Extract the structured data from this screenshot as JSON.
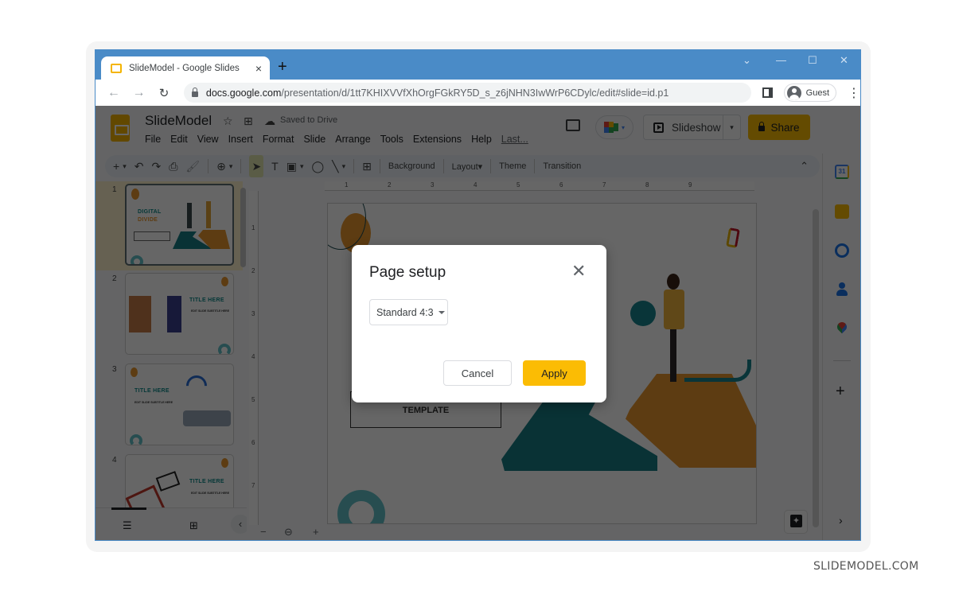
{
  "browser": {
    "tab_title": "SlideModel - Google Slides",
    "tab_close_icon": "×",
    "new_tab_icon": "+",
    "window_controls": {
      "tab_search": "⌄",
      "minimize": "—",
      "maximize": "☐",
      "close": "✕"
    },
    "nav": {
      "back": "←",
      "forward": "→",
      "reload": "↻"
    },
    "url_host": "docs.google.com",
    "url_path": "/presentation/d/1tt7KHIXVVfXhOrgFGkRY5D_s_z6jNHN3IwWrP6CDylc/edit#slide=id.p1",
    "profile_label": "Guest",
    "menu_icon": "⋮"
  },
  "app": {
    "doc_title": "SlideModel",
    "star_icon": "☆",
    "move_icon": "⊞",
    "saved_status": "Saved to Drive",
    "cloud_icon": "☁",
    "menu": [
      "File",
      "Edit",
      "View",
      "Insert",
      "Format",
      "Slide",
      "Arrange",
      "Tools",
      "Extensions",
      "Help"
    ],
    "last_edit": "Last...",
    "slideshow_label": "Slideshow",
    "slideshow_dropdown": "▾",
    "share_label": "Share",
    "meet_dropdown": "▾"
  },
  "toolbar": {
    "new_slide": "+",
    "dropdown": "▾",
    "undo": "↶",
    "redo": "↷",
    "print": "⎙",
    "paint_format": "🖌",
    "zoom": "⊕",
    "select": "➤",
    "textbox": "T",
    "image": "▣",
    "shape": "◯",
    "line": "╲",
    "comment": "⊞",
    "background": "Background",
    "layout": "Layout",
    "layout_caret": "▾",
    "theme": "Theme",
    "transition": "Transition",
    "collapse": "⌃"
  },
  "filmstrip": {
    "slides": [
      {
        "number": "1",
        "title_line1": "DIGITAL",
        "title_line2": "DIVIDE"
      },
      {
        "number": "2",
        "title": "TITLE HERE",
        "subtitle": "EDIT SLIDE SUBTITLE HERE"
      },
      {
        "number": "3",
        "title": "TITLE HERE",
        "subtitle": "EDIT SLIDE SUBTITLE HERE"
      },
      {
        "number": "4",
        "title": "TITLE HERE",
        "subtitle": "EDIT SLIDE SUBTITLE HERE"
      }
    ],
    "list_view_icon": "☰",
    "grid_view_icon": "⊞",
    "collapse_icon": "‹"
  },
  "canvas": {
    "ruler_h_labels": [
      "1",
      "2",
      "3",
      "4",
      "5",
      "6",
      "7",
      "8",
      "9"
    ],
    "ruler_v_labels": [
      "1",
      "2",
      "3",
      "4",
      "5",
      "6",
      "7"
    ],
    "slide_button_text": "TEMPLATE",
    "zoom_out": "−",
    "zoom_icon": "⊖",
    "zoom_in": "+"
  },
  "side_panel": {
    "calendar_label": "31",
    "add_icon": "+",
    "expand_icon": "›"
  },
  "dialog": {
    "title": "Page setup",
    "close_icon": "✕",
    "size_value": "Standard 4:3",
    "cancel_label": "Cancel",
    "apply_label": "Apply"
  },
  "watermark": "SLIDEMODEL.COM",
  "colors": {
    "chrome_blue": "#4a8bc7",
    "share_yellow": "#fbbc04",
    "slides_yellow": "#f4b400",
    "teal": "#0d8a8a",
    "orange": "#e8962e"
  }
}
